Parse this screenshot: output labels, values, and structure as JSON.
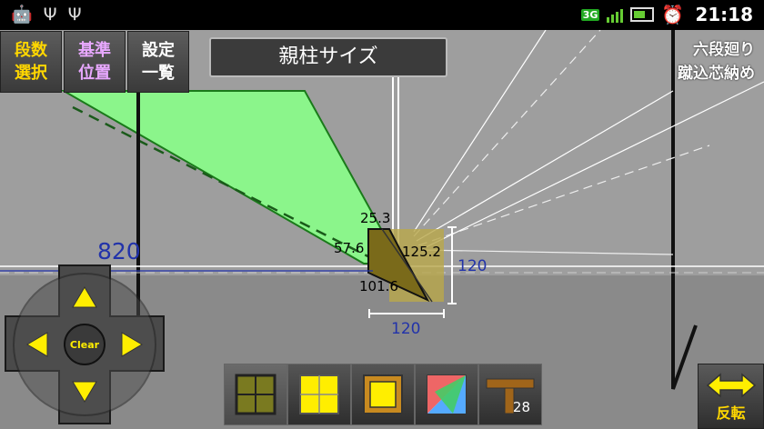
{
  "status_bar": {
    "network": "3G",
    "time": "21:18"
  },
  "toolbar_top": {
    "btn1": [
      "段数",
      "選択"
    ],
    "btn2": [
      "基準",
      "位置"
    ],
    "btn3": [
      "設定",
      "一覧"
    ]
  },
  "title": "親柱サイズ",
  "right_labels": {
    "line1": "六段廻り",
    "line2": "蹴込芯納め"
  },
  "measurements": {
    "left_width": "820",
    "m_top": "25.3",
    "m_left": "57.6",
    "m_diag": "125.2",
    "m_bottom": "101.6",
    "size_h": "120",
    "size_w": "120"
  },
  "dpad": {
    "center_label": "Clear"
  },
  "bottom_tools": {
    "badge": "28"
  },
  "reverse_button": {
    "label": "反転"
  },
  "colors": {
    "accent_green": "#8bf58b",
    "accent_yellow": "#ffee00",
    "measure_blue": "#2233aa"
  }
}
